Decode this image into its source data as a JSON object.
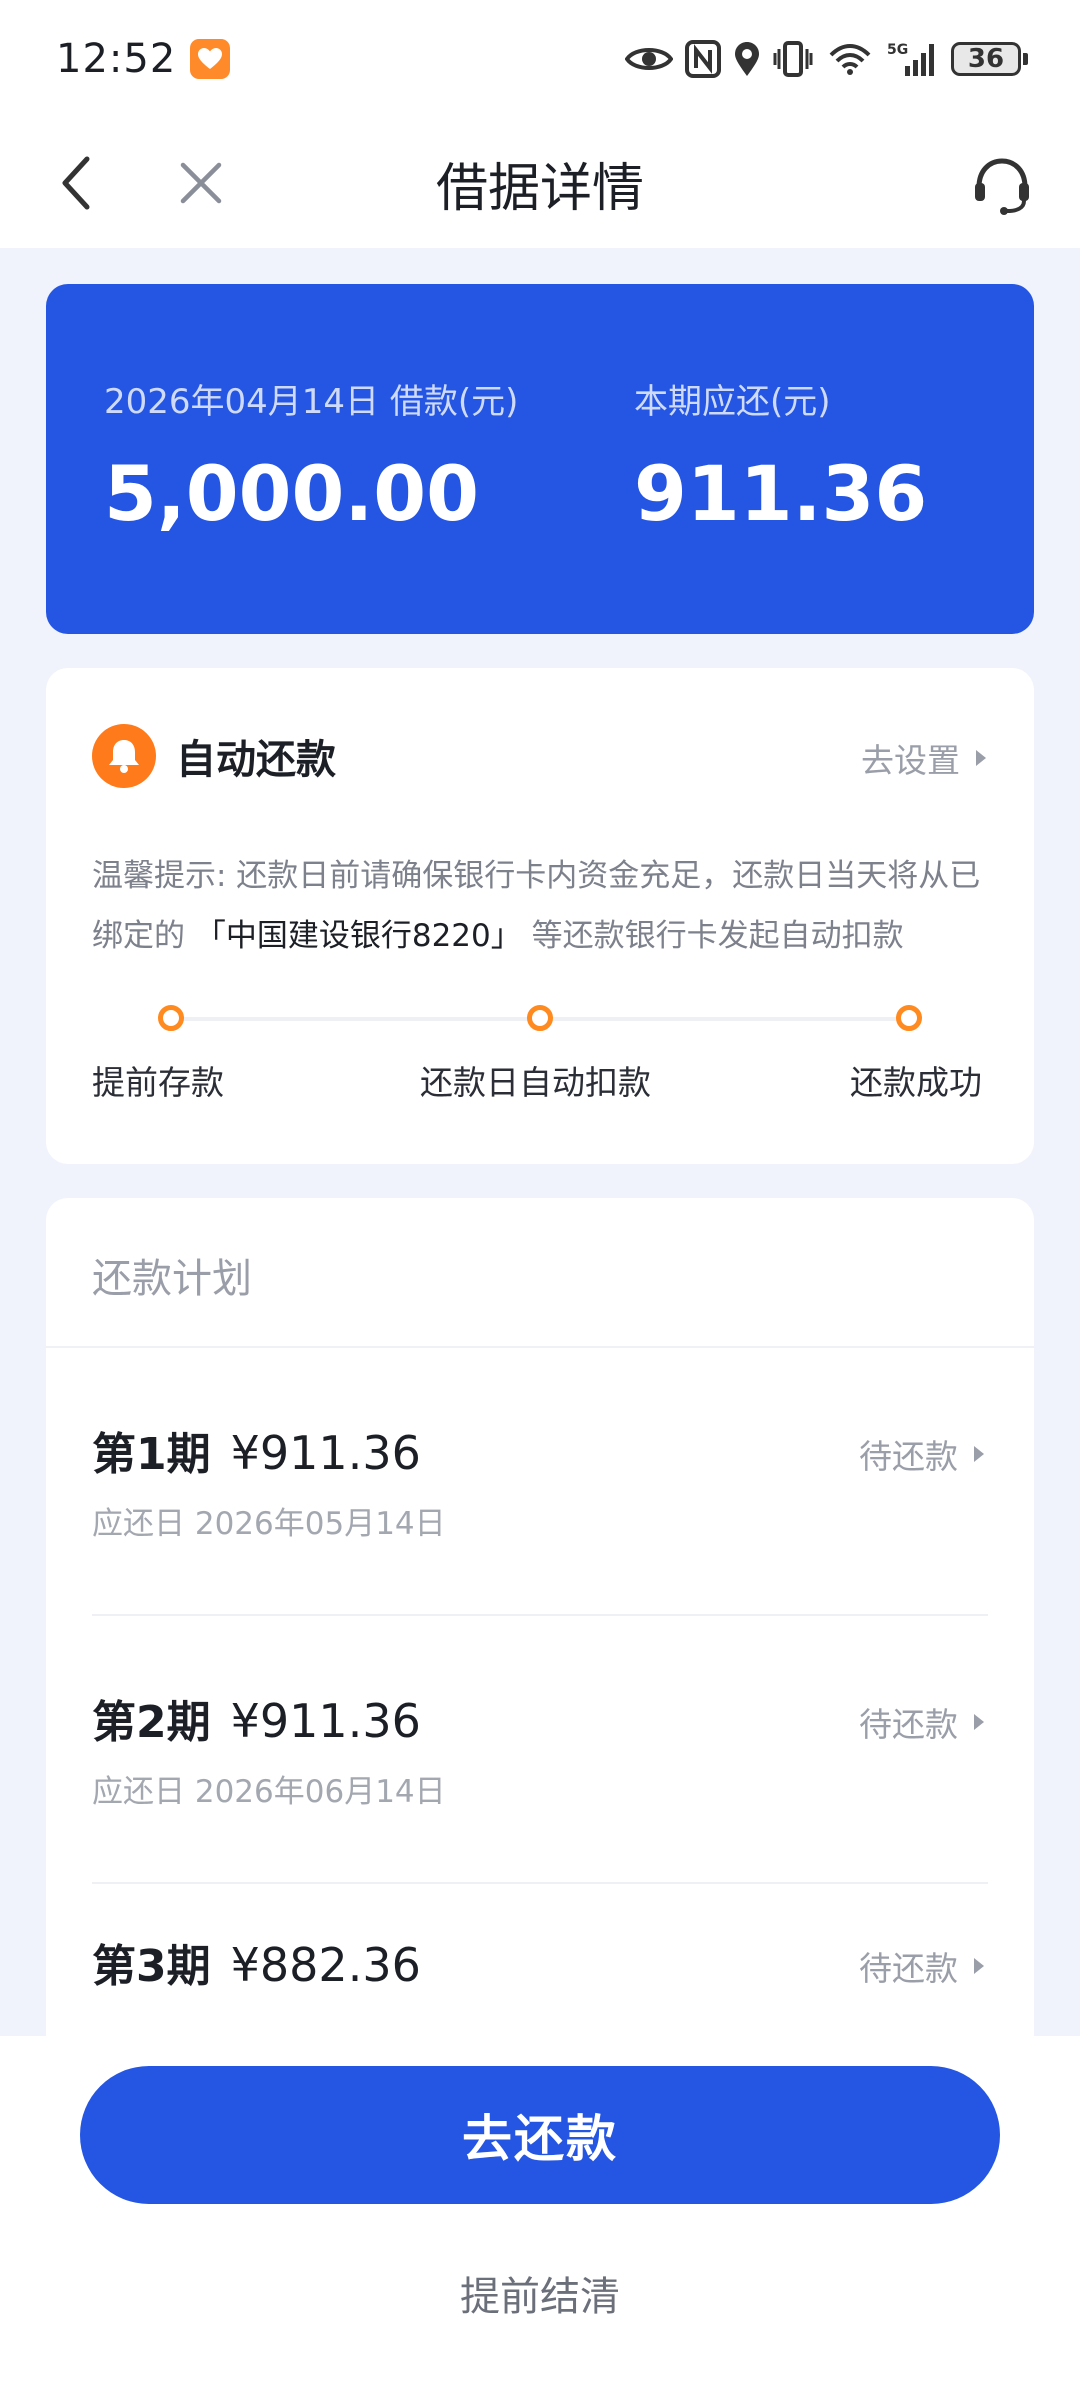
{
  "status_bar": {
    "time": "12:52",
    "network": "5G",
    "battery": "36"
  },
  "nav": {
    "title": "借据详情"
  },
  "loan": {
    "date_label": "2026年04月14日 借款(元)",
    "loan_amount": "5,000.00",
    "due_label": "本期应还(元)",
    "due_amount": "911.36"
  },
  "auto_repay": {
    "title": "自动还款",
    "setting_label": "去设置",
    "tip_prefix": "温馨提示: 还款日前请确保银行卡内资金充足，还款日当天将从已绑定的",
    "bank_name": "「中国建设银行8220」",
    "tip_suffix": "等还款银行卡发起自动扣款",
    "steps": [
      "提前存款",
      "还款日自动扣款",
      "还款成功"
    ]
  },
  "plan": {
    "title": "还款计划",
    "items": [
      {
        "period": "第1期",
        "amount": "¥911.36",
        "due": "应还日 2026年05月14日",
        "status": "待还款"
      },
      {
        "period": "第2期",
        "amount": "¥911.36",
        "due": "应还日 2026年06月14日",
        "status": "待还款"
      },
      {
        "period": "第3期",
        "amount": "¥882.36",
        "due": "",
        "status": "待还款"
      }
    ]
  },
  "actions": {
    "repay_label": "去还款",
    "settle_label": "提前结清"
  },
  "colors": {
    "primary": "#2456e3",
    "accent_orange": "#ff7a1a",
    "page_bg": "#f0f3fb"
  }
}
